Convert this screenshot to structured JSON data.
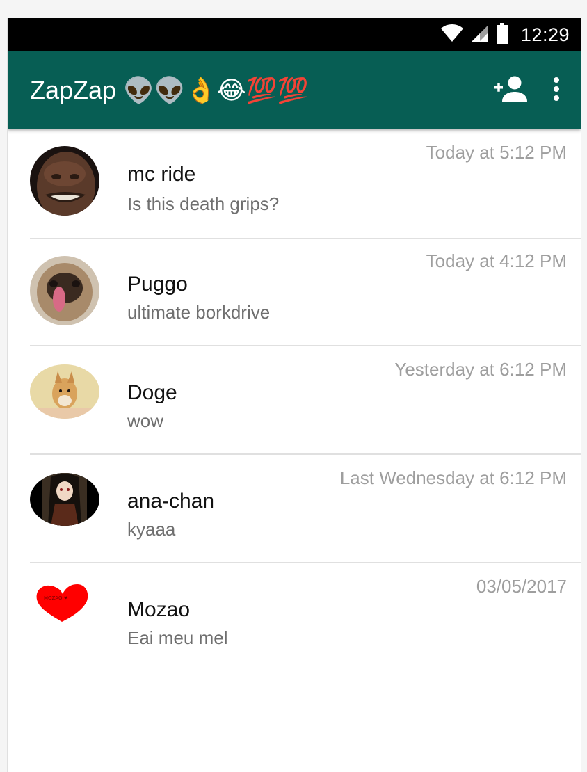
{
  "status_bar": {
    "time": "12:29",
    "icons": [
      "wifi-icon",
      "cell-signal-icon",
      "battery-icon"
    ]
  },
  "app_bar": {
    "title": "ZapZap",
    "title_emojis": "👽👽👌😂💯💯",
    "actions": [
      "add-contact-icon",
      "overflow-menu-icon"
    ],
    "color": "#075e54"
  },
  "chats": [
    {
      "name": "mc ride",
      "message": "Is this death grips?",
      "time": "Today at 5:12 PM",
      "avatar": "face-photo"
    },
    {
      "name": "Puggo",
      "message": "ultimate borkdrive",
      "time": "Today at 4:12 PM",
      "avatar": "pug-photo"
    },
    {
      "name": "Doge",
      "message": "wow",
      "time": "Yesterday at 6:12 PM",
      "avatar": "shiba-photo"
    },
    {
      "name": "ana-chan",
      "message": "kyaaa",
      "time": "Last Wednesday at 6:12 PM",
      "avatar": "anime-girl-photo"
    },
    {
      "name": "Mozao",
      "message": "Eai meu mel",
      "time": "03/05/2017",
      "avatar": "heart-image",
      "avatar_caption": "MOZAO ❤"
    }
  ]
}
